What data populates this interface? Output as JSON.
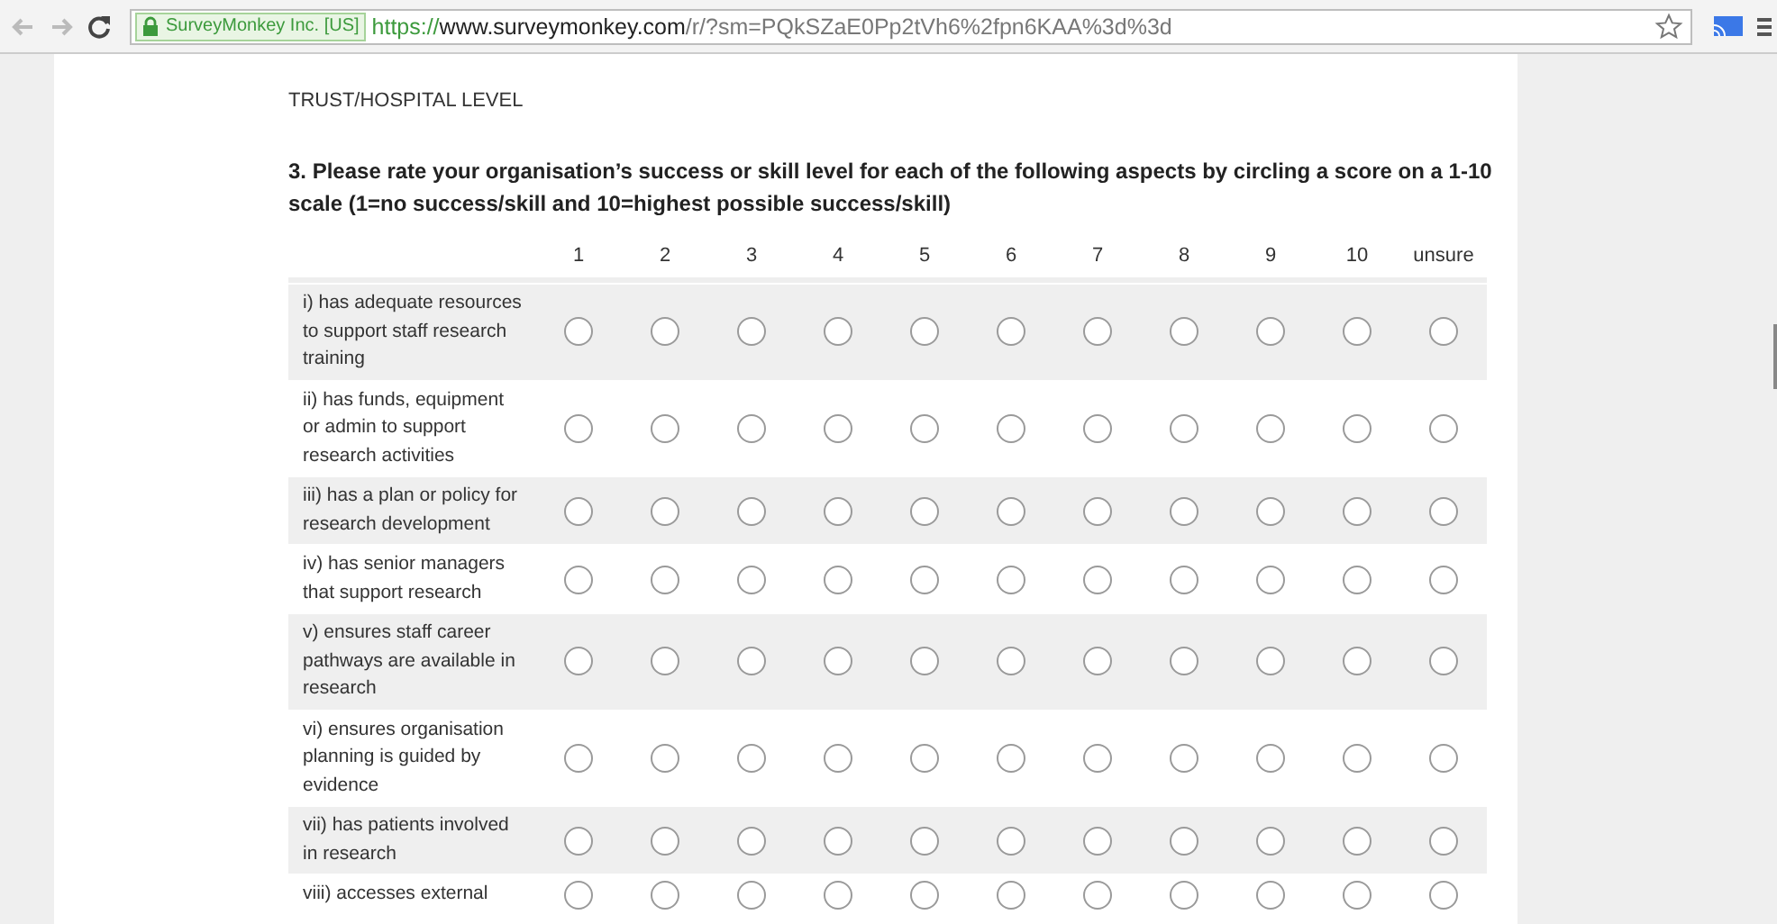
{
  "browser": {
    "ev_badge": "SurveyMonkey Inc. [US]",
    "url": {
      "scheme": "https://",
      "host": "www.surveymonkey.com",
      "path": "/r/?sm=PQkSZaE0Pp2tVh6%2fpn6KAA%3d%3d"
    },
    "bookmarked": false
  },
  "section_title": "TRUST/HOSPITAL LEVEL",
  "question": "3. Please rate your organisation’s success or skill level for each of the following aspects by circling a score on a 1-10 scale (1=no success/skill and 10=highest possible success/skill)",
  "scale": [
    "1",
    "2",
    "3",
    "4",
    "5",
    "6",
    "7",
    "8",
    "9",
    "10",
    "unsure"
  ],
  "rows": [
    {
      "label": "i) has adequate resources to support staff research training",
      "options": [
        {
          "selected": false
        },
        {
          "selected": false
        },
        {
          "selected": false
        },
        {
          "selected": false
        },
        {
          "selected": false
        },
        {
          "selected": false
        },
        {
          "selected": false
        },
        {
          "selected": false
        },
        {
          "selected": false
        },
        {
          "selected": false
        },
        {
          "selected": false
        }
      ]
    },
    {
      "label": "ii) has funds, equipment or admin to support research activities",
      "options": [
        {
          "selected": false
        },
        {
          "selected": false
        },
        {
          "selected": false
        },
        {
          "selected": false
        },
        {
          "selected": false
        },
        {
          "selected": false
        },
        {
          "selected": false
        },
        {
          "selected": false
        },
        {
          "selected": false
        },
        {
          "selected": false
        },
        {
          "selected": false
        }
      ]
    },
    {
      "label": "iii) has a plan or policy for research development",
      "options": [
        {
          "selected": false
        },
        {
          "selected": false
        },
        {
          "selected": false
        },
        {
          "selected": false
        },
        {
          "selected": false
        },
        {
          "selected": false
        },
        {
          "selected": false
        },
        {
          "selected": false
        },
        {
          "selected": false
        },
        {
          "selected": false
        },
        {
          "selected": false
        }
      ]
    },
    {
      "label": "iv) has senior managers that support research",
      "options": [
        {
          "selected": false
        },
        {
          "selected": false
        },
        {
          "selected": false
        },
        {
          "selected": false
        },
        {
          "selected": false
        },
        {
          "selected": false
        },
        {
          "selected": false
        },
        {
          "selected": false
        },
        {
          "selected": false
        },
        {
          "selected": false
        },
        {
          "selected": false
        }
      ]
    },
    {
      "label": "v) ensures staff career pathways are available in research",
      "options": [
        {
          "selected": false
        },
        {
          "selected": false
        },
        {
          "selected": false
        },
        {
          "selected": false
        },
        {
          "selected": false
        },
        {
          "selected": false
        },
        {
          "selected": false
        },
        {
          "selected": false
        },
        {
          "selected": false
        },
        {
          "selected": false
        },
        {
          "selected": false
        }
      ]
    },
    {
      "label": "vi) ensures organisation planning is guided by evidence",
      "options": [
        {
          "selected": false
        },
        {
          "selected": false
        },
        {
          "selected": false
        },
        {
          "selected": false
        },
        {
          "selected": false
        },
        {
          "selected": false
        },
        {
          "selected": false
        },
        {
          "selected": false
        },
        {
          "selected": false
        },
        {
          "selected": false
        },
        {
          "selected": false
        }
      ]
    },
    {
      "label": "vii) has patients involved in research",
      "options": [
        {
          "selected": false
        },
        {
          "selected": false
        },
        {
          "selected": false
        },
        {
          "selected": false
        },
        {
          "selected": false
        },
        {
          "selected": false
        },
        {
          "selected": false
        },
        {
          "selected": false
        },
        {
          "selected": false
        },
        {
          "selected": false
        },
        {
          "selected": false
        }
      ]
    },
    {
      "label": "viii) accesses external",
      "options": [
        {
          "selected": false
        },
        {
          "selected": false
        },
        {
          "selected": false
        },
        {
          "selected": false
        },
        {
          "selected": false
        },
        {
          "selected": false
        },
        {
          "selected": false
        },
        {
          "selected": false
        },
        {
          "selected": false
        },
        {
          "selected": false
        },
        {
          "selected": false
        }
      ]
    }
  ]
}
